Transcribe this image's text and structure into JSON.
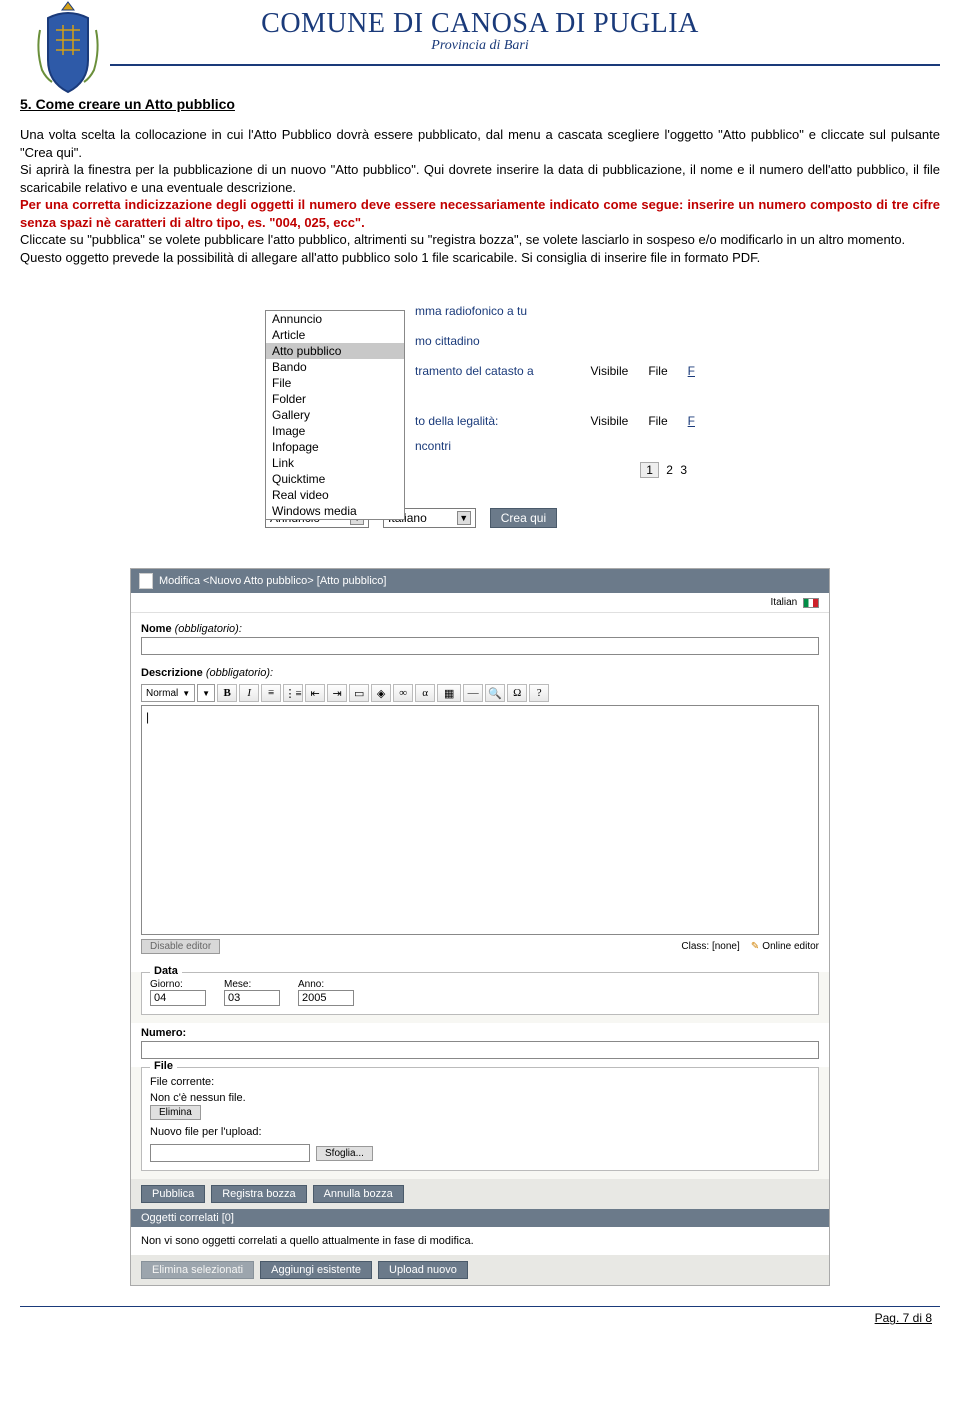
{
  "header": {
    "title": "COMUNE DI CANOSA DI PUGLIA",
    "subtitle": "Provincia di Bari"
  },
  "section": {
    "heading": "5. Come creare un Atto pubblico",
    "p1": "Una volta scelta la collocazione in cui l'Atto Pubblico dovrà essere pubblicato, dal menu a cascata scegliere l'oggetto \"Atto pubblico\" e cliccate sul pulsante \"Crea qui\".",
    "p2": "Si aprirà la finestra per la pubblicazione di un nuovo \"Atto pubblico\". Qui dovrete inserire la data di pubblicazione, il nome e il numero dell'atto pubblico, il file scaricabile relativo e una eventuale descrizione.",
    "p3_red": "Per una corretta indicizzazione degli oggetti  il numero deve essere necessariamente indicato come segue: inserire un numero composto di tre cifre senza spazi nè caratteri di altro tipo, es. \"004, 025, ecc\".",
    "p4": "Cliccate su \"pubblica\" se volete pubblicare l'atto pubblico, altrimenti su \"registra bozza\", se volete  lasciarlo in sospeso e/o modificarlo in un altro momento.",
    "p5": "Questo oggetto prevede la possibilità di allegare all'atto pubblico solo 1 file scaricabile. Si consiglia di inserire file in formato PDF."
  },
  "shot1": {
    "dropdown": [
      "Annuncio",
      "Article",
      "Atto pubblico",
      "Bando",
      "File",
      "Folder",
      "Gallery",
      "Image",
      "Infopage",
      "Link",
      "Quicktime",
      "Real video",
      "Windows media"
    ],
    "dropdown_selected": "Atto pubblico",
    "row0_frag": "mma radiofonico a tu",
    "row0b_frag": "mo cittadino",
    "row1_frag": "tramento del catasto a",
    "row2_frag": "to della legalità:",
    "row2b_frag": "ncontri",
    "col_vis": "Visibile",
    "col_file": "File",
    "col_f": "F",
    "pager": [
      "1",
      "2",
      "3"
    ],
    "bottom_select1": "Annuncio",
    "bottom_select2": "Italiano",
    "btn_crea": "Crea qui"
  },
  "shot2": {
    "titlebar": "Modifica <Nuovo Atto pubblico> [Atto pubblico]",
    "lang": "Italian",
    "lbl_nome": "Nome",
    "oblig": "(obbligatorio):",
    "lbl_descr": "Descrizione",
    "toolbar_style": "Normal",
    "editor_content": "|",
    "class_label": "Class: [none]",
    "btn_disable": "Disable editor",
    "online_editor": "Online editor",
    "legend_data": "Data",
    "lbl_giorno": "Giorno:",
    "lbl_mese": "Mese:",
    "lbl_anno": "Anno:",
    "val_giorno": "04",
    "val_mese": "03",
    "val_anno": "2005",
    "lbl_numero": "Numero:",
    "legend_file": "File",
    "lbl_file_corrente": "File corrente:",
    "txt_no_file": "Non c'è nessun file.",
    "btn_elimina": "Elimina",
    "lbl_upload": "Nuovo file per l'upload:",
    "btn_sfoglia": "Sfoglia...",
    "btn_pubblica": "Pubblica",
    "btn_bozza": "Registra bozza",
    "btn_annulla": "Annulla bozza",
    "related_title": "Oggetti correlati [0]",
    "related_text": "Non vi sono oggetti correlati a quello attualmente in fase di modifica.",
    "btn_elimina_sel": "Elimina selezionati",
    "btn_aggiungi": "Aggiungi esistente",
    "btn_upload_nuovo": "Upload nuovo"
  },
  "footer": {
    "page": "Pag. 7 di 8"
  }
}
